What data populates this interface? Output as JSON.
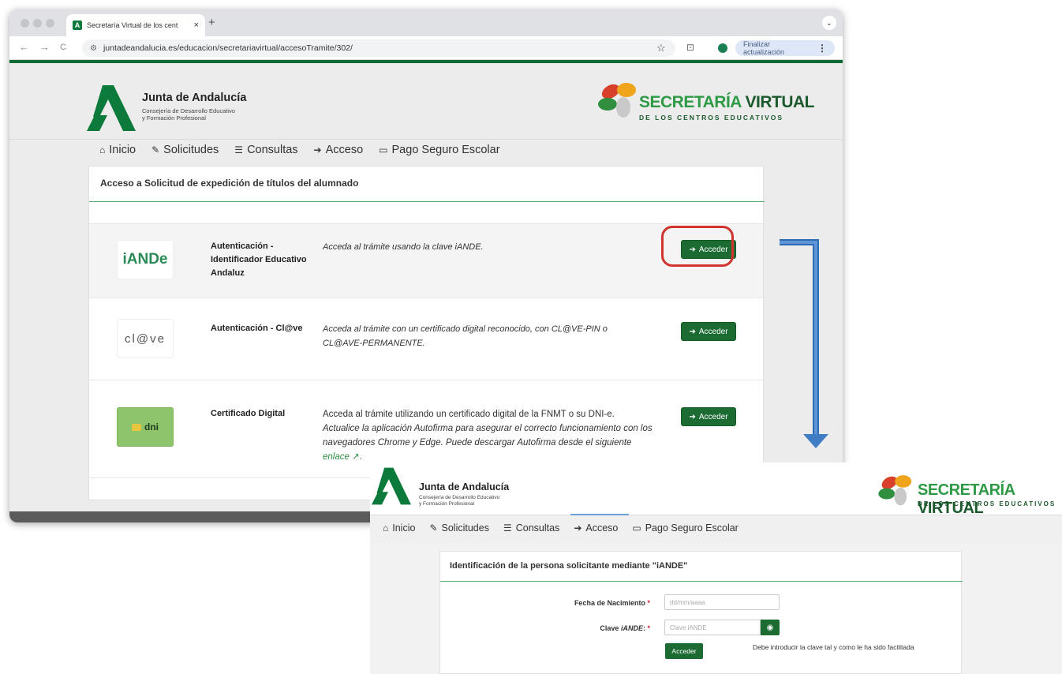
{
  "browser": {
    "tab_title": "Secretaría Virtual de los cent",
    "tab_close": "×",
    "new_tab": "+",
    "url": "juntadeandalucia.es/educacion/secretariavirtual/accesoTramite/302/",
    "update_button": "Finalizar actualización",
    "update_menu": "⋮",
    "back": "←",
    "forward": "→",
    "reload": "C",
    "star": "☆",
    "extensions": "⊡",
    "profile_chip": "⌄"
  },
  "site": {
    "org_name": "Junta de Andalucía",
    "org_sub_line1": "Consejería de Desarrollo Educativo",
    "org_sub_line2": "y Formación Profesional",
    "sv_title_part1": "SECRETARÍA ",
    "sv_title_part2": "VIRTUAL",
    "sv_subtitle": "DE LOS CENTROS EDUCATIVOS",
    "nav": [
      {
        "icon": "home-icon",
        "glyph": "⌂",
        "label": "Inicio"
      },
      {
        "icon": "pencil-icon",
        "glyph": "✎",
        "label": "Solicitudes"
      },
      {
        "icon": "list-icon",
        "glyph": "☰",
        "label": "Consultas"
      },
      {
        "icon": "sign-in-icon",
        "glyph": "➔",
        "label": "Acceso"
      },
      {
        "icon": "credit-card-icon",
        "glyph": "▭",
        "label": "Pago Seguro Escolar"
      }
    ]
  },
  "panel": {
    "title": "Acceso a Solicitud de expedición de títulos del alumnado",
    "button_label": "Acceder",
    "rows": [
      {
        "logo_text": "iANDe",
        "label": "Autenticación - Identificador Educativo Andaluz",
        "description": "Acceda al trámite usando la clave iANDE."
      },
      {
        "logo_text": "cl@ve",
        "label": "Autenticación - Cl@ve",
        "description": "Acceda al trámite con un certificado digital reconocido, con CL@VE-PIN o CL@AVE-PERMANENTE."
      },
      {
        "logo_text": "dni",
        "label": "Certificado Digital",
        "description_plain": "Acceda al trámite utilizando un certificado digital de la FNMT o su DNI-e.",
        "description_italic": "Actualice la aplicación Autofirma para asegurar el correcto funcionamiento con los navegadores Chrome y Edge. Puede descargar Autofirma desde el siguiente",
        "link_text": "enlace",
        "link_suffix": "."
      }
    ]
  },
  "overlay": {
    "panel_title": "Identificación de la persona solicitante mediante \"iANDE\"",
    "birth_label": "Fecha de Nacimiento",
    "birth_placeholder": "dd/mm/aaaa",
    "key_label_prefix": "Clave ",
    "key_label_italic": "iANDE",
    "key_label_suffix": ":",
    "required_mark": "*",
    "key_placeholder": "Clave iANDE",
    "submit": "Acceder",
    "help": "Debe introducir la clave tal y como le ha sido facilitada"
  },
  "colors": {
    "brand_green": "#1b6b33",
    "highlight_red": "#d0342c",
    "arrow_blue": "#3f7cc4"
  }
}
